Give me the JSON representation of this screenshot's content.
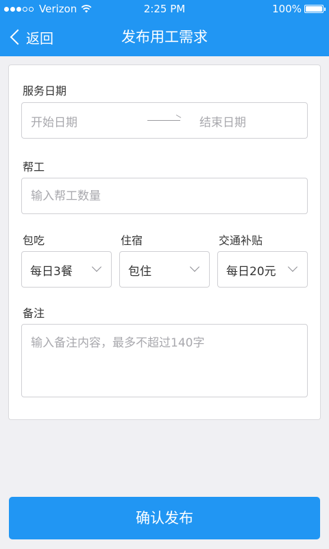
{
  "status_bar": {
    "carrier": "Verizon",
    "time": "2:25 PM",
    "battery": "100%",
    "battery_level": 1.0,
    "signal_filled": 3,
    "signal_total": 5
  },
  "nav": {
    "back_label": "返回",
    "title": "发布用工需求",
    "color": "#2196f3"
  },
  "form": {
    "service_date": {
      "label": "服务日期",
      "start_placeholder": "开始日期",
      "end_placeholder": "结束日期"
    },
    "helper": {
      "label": "帮工",
      "placeholder": "输入帮工数量"
    },
    "meals": {
      "label": "包吃",
      "value": "每日3餐"
    },
    "lodging": {
      "label": "住宿",
      "value": "包住"
    },
    "transport": {
      "label": "交通补贴",
      "value": "每日20元"
    },
    "remarks": {
      "label": "备注",
      "placeholder": "输入备注内容，最多不超过140字"
    }
  },
  "confirm_button": {
    "label": "确认发布"
  },
  "icons": {
    "back": "chevron-left-icon",
    "wifi": "wifi-icon",
    "battery": "battery-icon",
    "arrow": "arrow-right-icon",
    "select": "chevron-down-icon"
  }
}
